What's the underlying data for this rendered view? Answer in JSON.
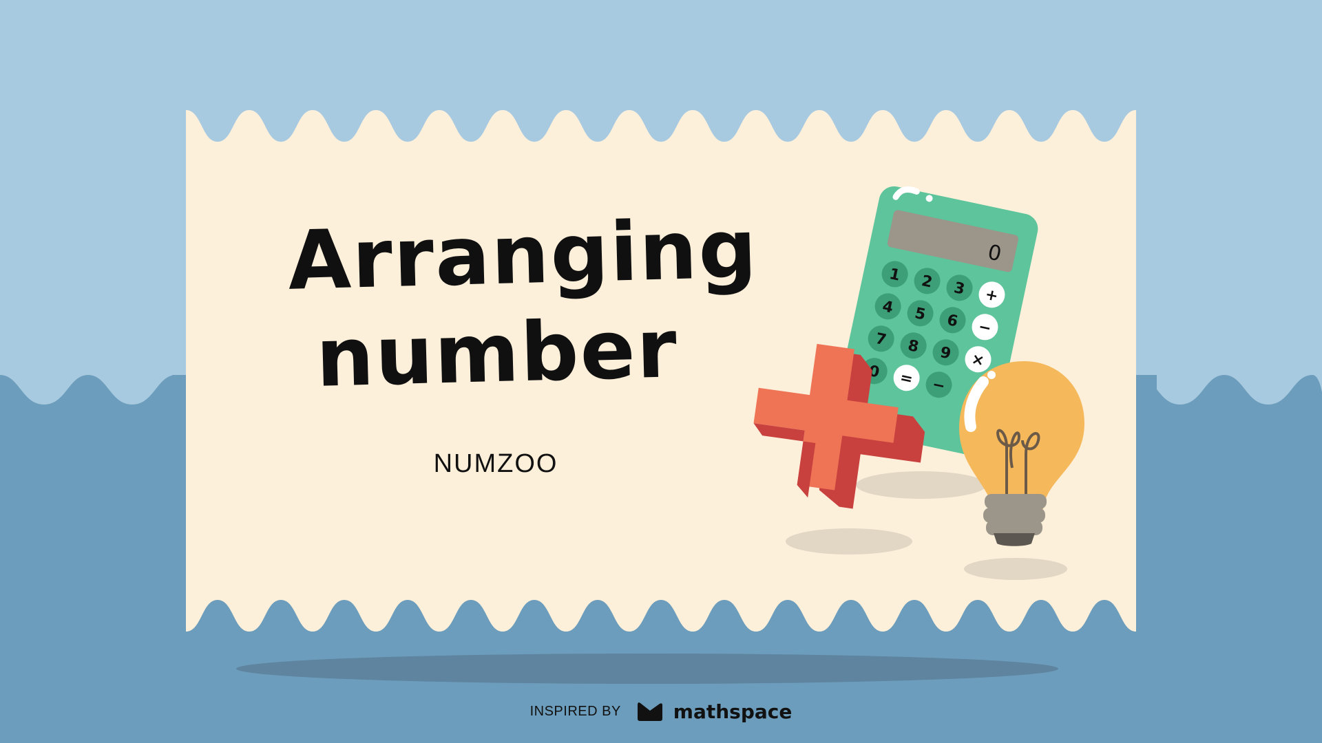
{
  "slide": {
    "title_line1": "Arranging",
    "title_line2": "number",
    "subtitle": "NUMZOO"
  },
  "illustration": {
    "calculator_display": "0",
    "calculator_keys": [
      "1",
      "2",
      "3",
      "+",
      "4",
      "5",
      "6",
      "−",
      "7",
      "8",
      "9",
      "×",
      "0",
      "=",
      "−"
    ],
    "icons": [
      "calculator-icon",
      "plus-sign-icon",
      "lightbulb-icon"
    ]
  },
  "footer": {
    "inspired_label": "INSPIRED BY",
    "brand_name": "mathspace",
    "brand_icon": "mathspace-logo-icon"
  },
  "colors": {
    "sky": "#a8cae0",
    "sea": "#6c9dbc",
    "card": "#fdf0db",
    "calculator": "#5dc49b",
    "plus": "#ee7455",
    "bulb": "#f5b85a"
  }
}
